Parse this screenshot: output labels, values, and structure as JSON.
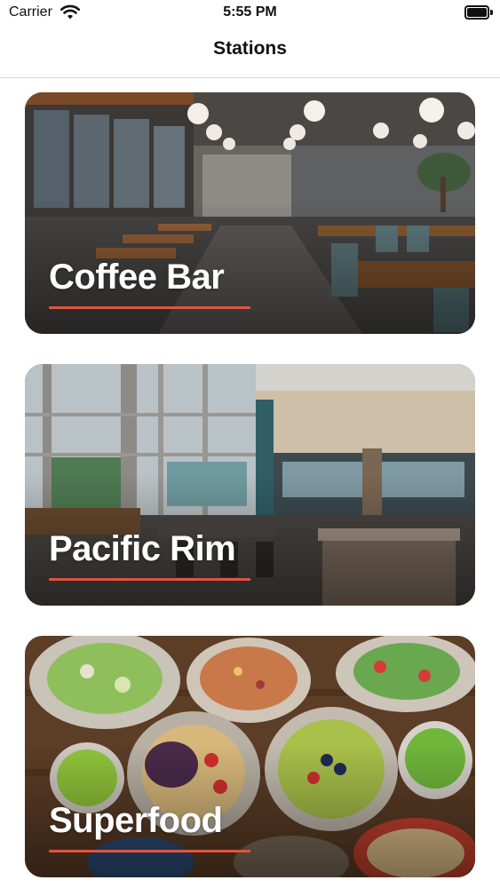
{
  "status_bar": {
    "carrier": "Carrier",
    "time": "5:55 PM",
    "wifi_icon": "wifi-icon",
    "battery_icon": "battery-icon"
  },
  "nav": {
    "title": "Stations"
  },
  "stations": [
    {
      "name": "Coffee Bar",
      "image": "cafe-interior-photo"
    },
    {
      "name": "Pacific Rim",
      "image": "dining-hall-photo"
    },
    {
      "name": "Superfood",
      "image": "salad-bowls-photo"
    }
  ],
  "colors": {
    "underline_accent": "#e1553f",
    "title_text": "#ffffff"
  }
}
